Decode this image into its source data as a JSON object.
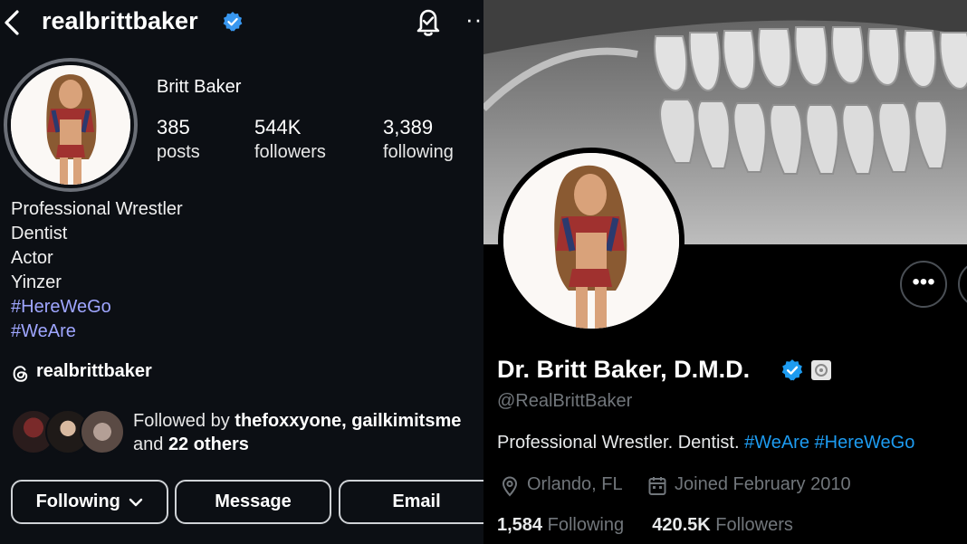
{
  "instagram": {
    "handle": "realbrittbaker",
    "display_name": "Britt Baker",
    "stats": [
      {
        "value": "385",
        "label": "posts"
      },
      {
        "value": "544K",
        "label": "followers"
      },
      {
        "value": "3,389",
        "label": "following"
      }
    ],
    "bio_lines": [
      "Professional Wrestler",
      "Dentist",
      "Actor",
      "Yinzer"
    ],
    "hashtags": [
      "#HereWeGo",
      "#WeAre"
    ],
    "threads_handle": "realbrittbaker",
    "followed_by_prefix": "Followed by ",
    "followed_by_names": "thefoxxyone, gailkimitsme",
    "followed_by_and": "and ",
    "followed_by_others": "22 others",
    "buttons": {
      "following": "Following",
      "message": "Message",
      "email": "Email"
    },
    "icons": [
      "back-arrow-icon",
      "verified-badge-icon",
      "notification-bell-icon",
      "more-options-icon",
      "threads-icon",
      "chevron-down-icon"
    ],
    "colors": {
      "background": "#0c0f14",
      "hashtag": "#9fa6ff",
      "verified": "#3897f0"
    }
  },
  "twitter": {
    "display_name": "Dr. Britt Baker, D.M.D.",
    "handle": "@RealBrittBaker",
    "bio_text": "Professional Wrestler. Dentist. ",
    "bio_hashtags": [
      "#WeAre",
      "#HereWeGo"
    ],
    "location": "Orlando, FL",
    "joined": "Joined February 2010",
    "following_count": "1,584",
    "following_label": "Following",
    "followers_count": "420.5K",
    "followers_label": "Followers",
    "icons": [
      "verified-badge-icon",
      "affiliate-badge-icon",
      "more-options-icon",
      "location-pin-icon",
      "calendar-icon"
    ],
    "colors": {
      "background": "#000000",
      "link": "#1d9bf0",
      "muted": "#71767b",
      "verified": "#1d9bf0"
    }
  }
}
